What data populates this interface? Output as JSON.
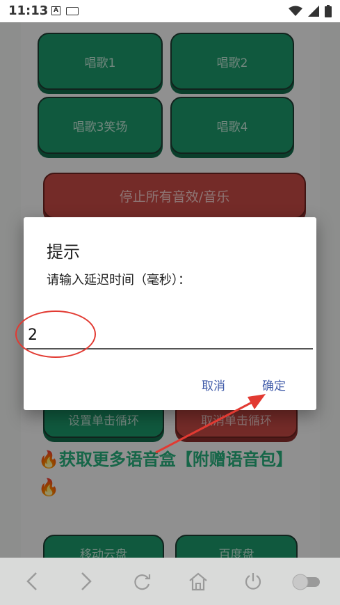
{
  "status_bar": {
    "time": "11:13",
    "left_icons": [
      "a-notification-icon",
      "keyboard-icon"
    ],
    "right_icons": [
      "wifi-icon",
      "signal-icon",
      "battery-icon"
    ]
  },
  "app": {
    "sing_buttons": [
      "唱歌1",
      "唱歌2",
      "唱歌3笑场",
      "唱歌4"
    ],
    "stop_button": "停止所有音效/音乐",
    "set_loop_button": "设置单击循环",
    "cancel_loop_button": "取消单击循环",
    "promo_text": "🔥获取更多语音盒【附赠语音包】🔥",
    "bottom_buttons": [
      "移动云盘",
      "百度盘"
    ]
  },
  "dialog": {
    "title": "提示",
    "message": "请输入延迟时间（毫秒）：",
    "input_value": "2",
    "cancel_label": "取消",
    "confirm_label": "确定"
  },
  "colors": {
    "green": "#1d9a6c",
    "red": "#c94a45",
    "dialog_button": "#3f5aa8",
    "annotation": "#e23a32"
  },
  "nav_bar": {
    "icons": [
      "back-icon",
      "forward-icon",
      "refresh-icon",
      "home-icon",
      "power-icon",
      "toggle-switch"
    ]
  }
}
